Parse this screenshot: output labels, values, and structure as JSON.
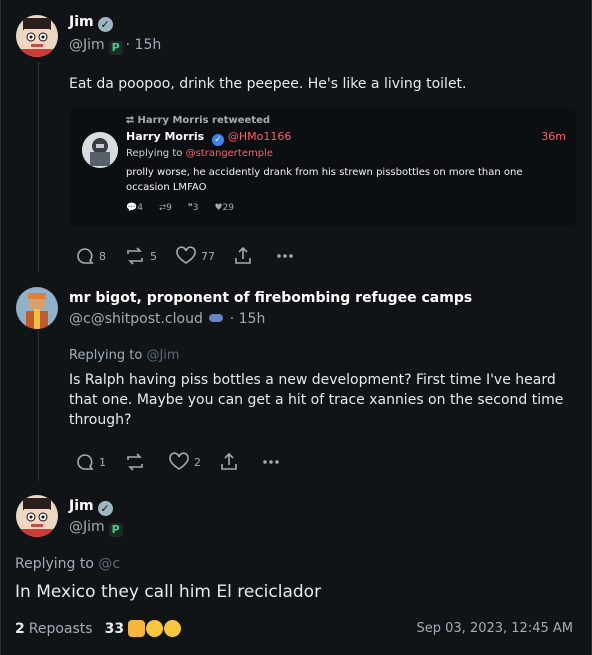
{
  "posts": [
    {
      "author": "Jim",
      "handle": "@Jim",
      "time": "· 15h",
      "text": "Eat da poopoo, drink the peepee.  He's like a living toilet.",
      "quote": {
        "retweeted_by": "Harry Morris retweeted",
        "author": "Harry Morris",
        "handle": "@HMo1166",
        "time": "36m",
        "replying_label": "Replying to",
        "replying_to": "@strangertemple",
        "text": "prolly worse, he accidently drank from his strewn pissbottles on more than one occasion LMFAO",
        "replies": "4",
        "retweets": "9",
        "quotes": "3",
        "likes": "29"
      },
      "counts": {
        "replies": "8",
        "reposts": "5",
        "likes": "77"
      }
    },
    {
      "author": "mr bigot, proponent of firebombing refugee camps",
      "handle": "@c@shitpost.cloud",
      "time": "· 15h",
      "replying_label": "Replying to",
      "replying_to": "@Jim",
      "text": "Is Ralph having piss bottles a new development? First time I've heard that one. Maybe you can get a hit of trace xannies on the second time through?",
      "counts": {
        "replies": "1",
        "reposts": "",
        "likes": "2"
      }
    },
    {
      "author": "Jim",
      "handle": "@Jim",
      "replying_label": "Replying to",
      "replying_to": "@c",
      "text": "In Mexico they call him El reciclador"
    }
  ],
  "footer": {
    "reposts_count": "2",
    "reposts_label": "Repoasts",
    "reactions_count": "33",
    "timestamp": "Sep 03, 2023, 12:45 AM"
  },
  "colors": {
    "background": "#101417",
    "accent_red": "#ff5b6e",
    "muted": "#a3acb4"
  }
}
